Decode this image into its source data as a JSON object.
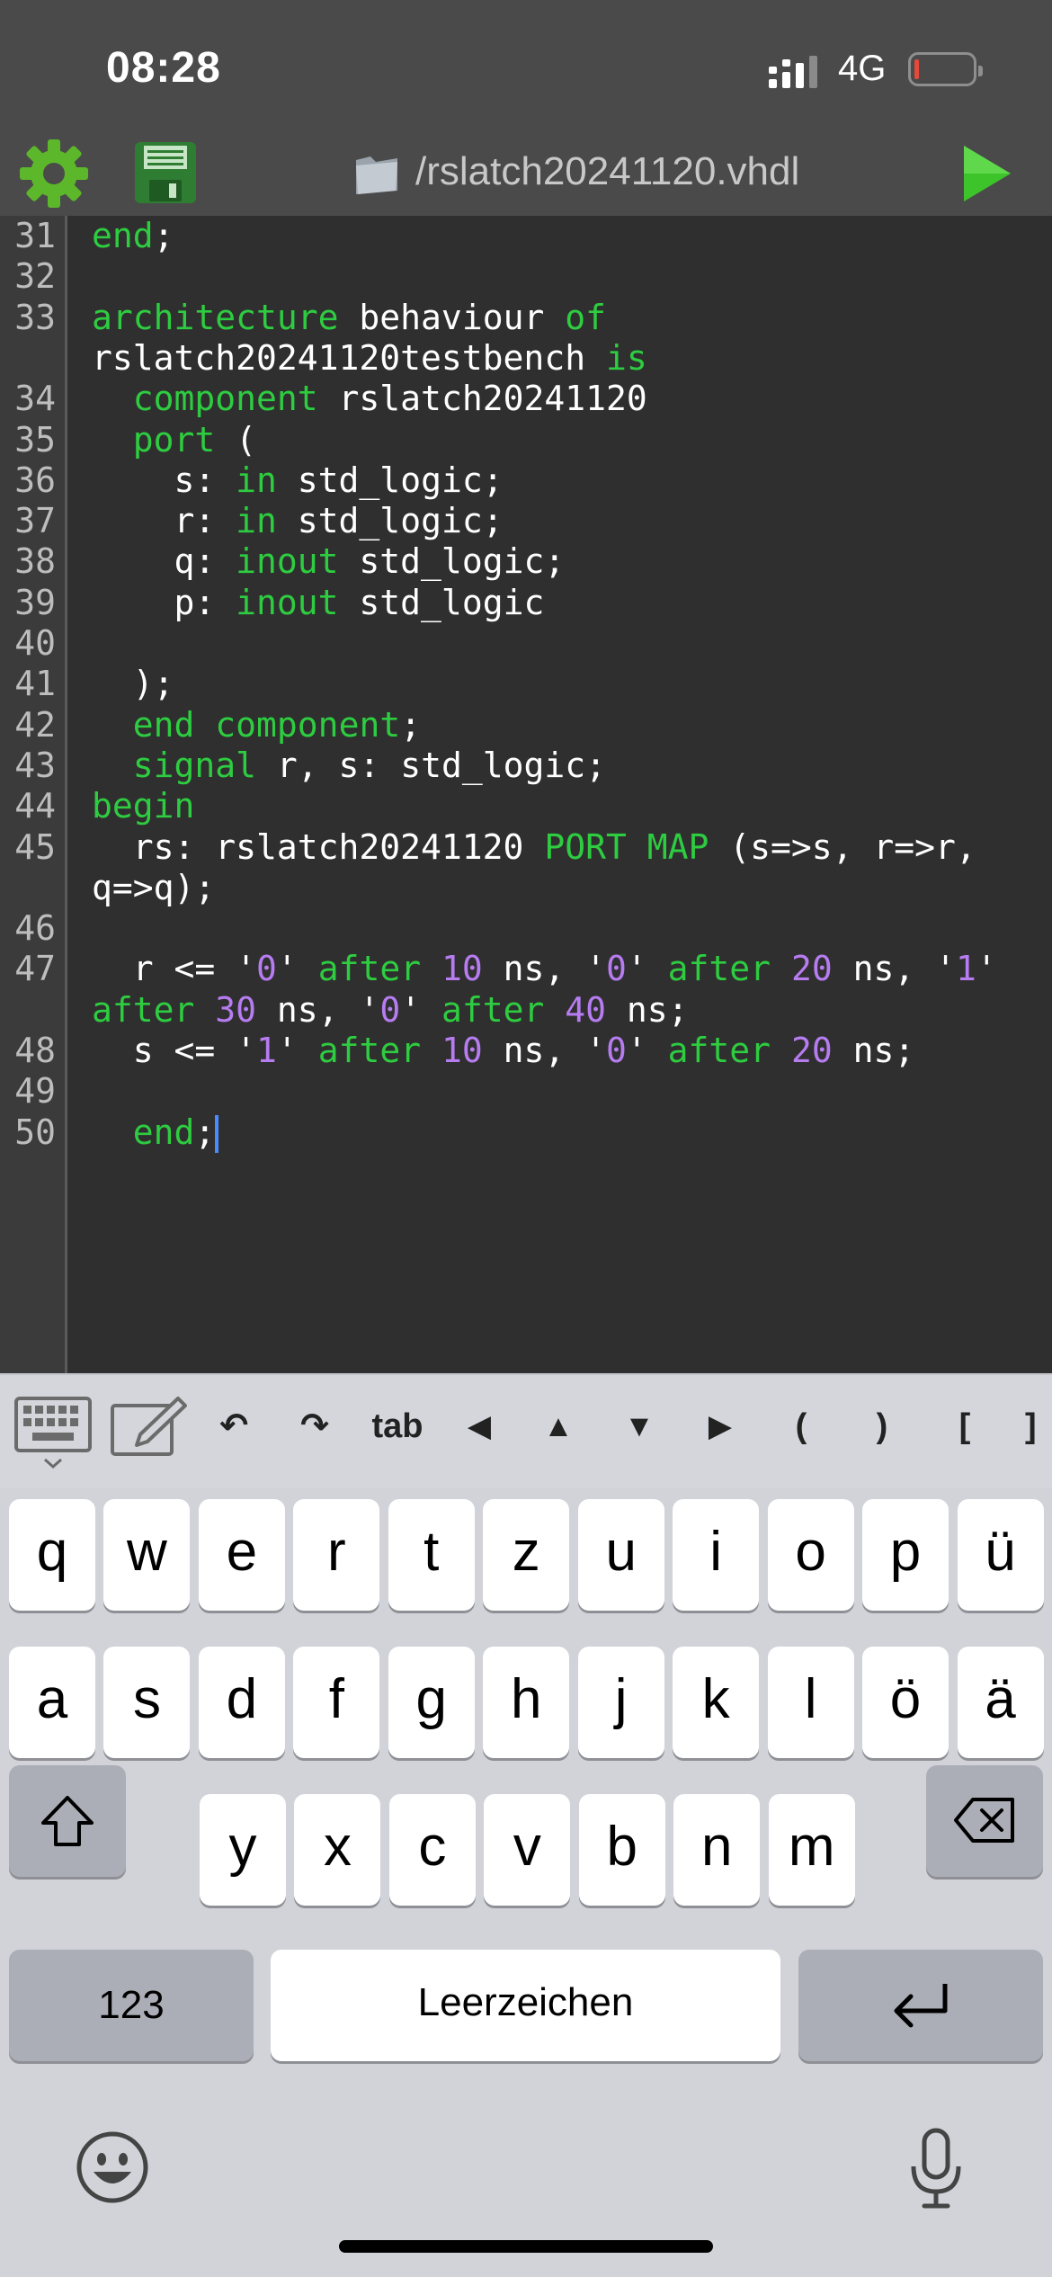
{
  "status_bar": {
    "time": "08:28",
    "network": "4G"
  },
  "toolbar": {
    "file_path": "/rslatch20241120.vhdl"
  },
  "code_lines": [
    {
      "ln": "31",
      "seg": [
        [
          "end",
          "kw"
        ],
        [
          ";",
          ""
        ]
      ]
    },
    {
      "ln": "32",
      "seg": []
    },
    {
      "ln": "33",
      "seg": [
        [
          "architecture",
          "kw"
        ],
        [
          " behaviour ",
          ""
        ],
        [
          "of",
          "kw"
        ]
      ]
    },
    {
      "ln": "",
      "seg": [
        [
          "rslatch20241120testbench ",
          ""
        ],
        [
          "is",
          "kw"
        ]
      ]
    },
    {
      "ln": "34",
      "seg": [
        [
          "  ",
          ""
        ],
        [
          "component",
          "kw"
        ],
        [
          " rslatch20241120",
          ""
        ]
      ]
    },
    {
      "ln": "35",
      "seg": [
        [
          "  ",
          ""
        ],
        [
          "port",
          "kw"
        ],
        [
          " (",
          ""
        ]
      ]
    },
    {
      "ln": "36",
      "seg": [
        [
          "    s: ",
          ""
        ],
        [
          "in",
          "kw"
        ],
        [
          " std_logic;",
          ""
        ]
      ]
    },
    {
      "ln": "37",
      "seg": [
        [
          "    r: ",
          ""
        ],
        [
          "in",
          "kw"
        ],
        [
          " std_logic;",
          ""
        ]
      ]
    },
    {
      "ln": "38",
      "seg": [
        [
          "    q: ",
          ""
        ],
        [
          "inout",
          "kw"
        ],
        [
          " std_logic;",
          ""
        ]
      ]
    },
    {
      "ln": "39",
      "seg": [
        [
          "    p: ",
          ""
        ],
        [
          "inout",
          "kw"
        ],
        [
          " std_logic",
          ""
        ]
      ]
    },
    {
      "ln": "40",
      "seg": []
    },
    {
      "ln": "41",
      "seg": [
        [
          "  );",
          ""
        ]
      ]
    },
    {
      "ln": "42",
      "seg": [
        [
          "  ",
          ""
        ],
        [
          "end",
          "kw"
        ],
        [
          " ",
          ""
        ],
        [
          "component",
          "kw"
        ],
        [
          ";",
          ""
        ]
      ]
    },
    {
      "ln": "43",
      "seg": [
        [
          "  ",
          ""
        ],
        [
          "signal",
          "kw"
        ],
        [
          " r, s: std_logic;",
          ""
        ]
      ]
    },
    {
      "ln": "44",
      "seg": [
        [
          "begin",
          "kw"
        ]
      ]
    },
    {
      "ln": "45",
      "seg": [
        [
          "  rs: rslatch20241120 ",
          ""
        ],
        [
          "PORT MAP",
          "kw"
        ],
        [
          " (s=>s, r=>r,",
          ""
        ]
      ]
    },
    {
      "ln": "",
      "seg": [
        [
          "q=>q);",
          ""
        ]
      ]
    },
    {
      "ln": "46",
      "seg": []
    },
    {
      "ln": "47",
      "seg": [
        [
          "  r <= '",
          ""
        ],
        [
          "0",
          "num"
        ],
        [
          "' ",
          ""
        ],
        [
          "after",
          "kw"
        ],
        [
          " ",
          ""
        ],
        [
          "10",
          "num"
        ],
        [
          " ns, '",
          ""
        ],
        [
          "0",
          "num"
        ],
        [
          "' ",
          ""
        ],
        [
          "after",
          "kw"
        ],
        [
          " ",
          ""
        ],
        [
          "20",
          "num"
        ],
        [
          " ns, '",
          ""
        ],
        [
          "1",
          "num"
        ],
        [
          "'",
          ""
        ]
      ]
    },
    {
      "ln": "",
      "seg": [
        [
          "after",
          "kw"
        ],
        [
          " ",
          ""
        ],
        [
          "30",
          "num"
        ],
        [
          " ns, '",
          ""
        ],
        [
          "0",
          "num"
        ],
        [
          "' ",
          ""
        ],
        [
          "after",
          "kw"
        ],
        [
          " ",
          ""
        ],
        [
          "40",
          "num"
        ],
        [
          " ns;",
          ""
        ]
      ]
    },
    {
      "ln": "48",
      "seg": [
        [
          "  s <= '",
          ""
        ],
        [
          "1",
          "num"
        ],
        [
          "' ",
          ""
        ],
        [
          "after",
          "kw"
        ],
        [
          " ",
          ""
        ],
        [
          "10",
          "num"
        ],
        [
          " ns, '",
          ""
        ],
        [
          "0",
          "num"
        ],
        [
          "' ",
          ""
        ],
        [
          "after",
          "kw"
        ],
        [
          " ",
          ""
        ],
        [
          "20",
          "num"
        ],
        [
          " ns;",
          ""
        ]
      ]
    },
    {
      "ln": "49",
      "seg": []
    },
    {
      "ln": "50",
      "seg": [
        [
          "  ",
          ""
        ],
        [
          "end",
          "kw"
        ],
        [
          ";",
          ""
        ]
      ],
      "cursor": true
    }
  ],
  "accessory_bar": {
    "keyboard_icon": "keyboard-hide-icon",
    "edit_icon": "edit-icon",
    "undo": "↶",
    "redo": "↷",
    "tab": "tab",
    "left": "◀",
    "up": "▲",
    "down": "▼",
    "right": "▶",
    "paren_open": "(",
    "paren_close": ")",
    "bracket_open": "[",
    "bracket_close": "]"
  },
  "keyboard": {
    "row1": [
      "q",
      "w",
      "e",
      "r",
      "t",
      "z",
      "u",
      "i",
      "o",
      "p",
      "ü"
    ],
    "row2": [
      "a",
      "s",
      "d",
      "f",
      "g",
      "h",
      "j",
      "k",
      "l",
      "ö",
      "ä"
    ],
    "row3": [
      "y",
      "x",
      "c",
      "v",
      "b",
      "n",
      "m"
    ],
    "numbers_label": "123",
    "space_label": "Leerzeichen",
    "shift_icon": "shift-icon",
    "backspace_icon": "backspace-icon",
    "return_icon": "return-icon",
    "emoji_icon": "emoji-icon",
    "mic_icon": "microphone-icon"
  },
  "colors": {
    "keyword": "#2ecc40",
    "number": "#b67cf0",
    "editor_bg": "#2f2f2f",
    "toolbar_bg": "#4a4a4a"
  }
}
